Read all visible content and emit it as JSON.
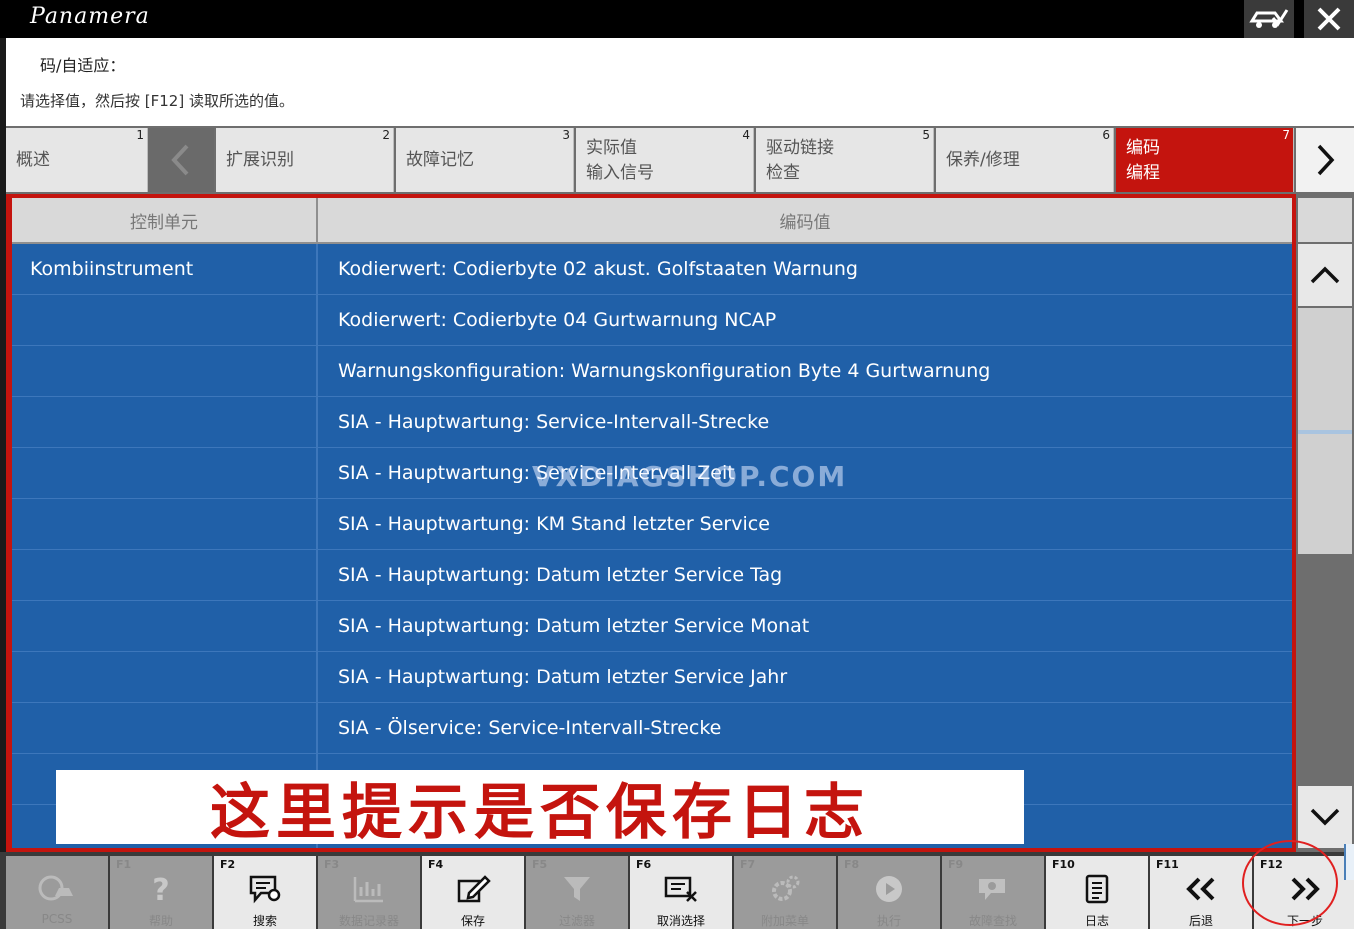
{
  "window": {
    "logo": "Panamera"
  },
  "header": {
    "title": "码/自适应：",
    "instruction": "请选择值，然后按 [F12] 读取所选的值。"
  },
  "tabs": [
    {
      "num": "1",
      "label": "概述"
    },
    {
      "num": "2",
      "label": "扩展识别"
    },
    {
      "num": "3",
      "label": "故障记忆"
    },
    {
      "num": "4",
      "label": "实际值\n输入信号"
    },
    {
      "num": "5",
      "label": "驱动链接\n检查"
    },
    {
      "num": "6",
      "label": "保养/修理"
    },
    {
      "num": "7",
      "label": "编码\n编程"
    }
  ],
  "table": {
    "col_control_unit": "控制单元",
    "col_coding_value": "编码值",
    "rows": [
      {
        "unit": "Kombiinstrument",
        "value": "Kodierwert: Codierbyte 02 akust. Golfstaaten Warnung"
      },
      {
        "unit": "",
        "value": "Kodierwert: Codierbyte 04 Gurtwarnung NCAP"
      },
      {
        "unit": "",
        "value": "Warnungskonfiguration: Warnungskonfiguration Byte 4 Gurtwarnung"
      },
      {
        "unit": "",
        "value": "SIA - Hauptwartung: Service-Intervall-Strecke"
      },
      {
        "unit": "",
        "value": "SIA - Hauptwartung: Service-Intervall Zeit"
      },
      {
        "unit": "",
        "value": "SIA - Hauptwartung: KM Stand letzter Service"
      },
      {
        "unit": "",
        "value": "SIA - Hauptwartung: Datum letzter Service Tag"
      },
      {
        "unit": "",
        "value": "SIA - Hauptwartung: Datum letzter Service Monat"
      },
      {
        "unit": "",
        "value": "SIA - Hauptwartung: Datum letzter Service Jahr"
      },
      {
        "unit": "",
        "value": "SIA - Ölservice: Service-Intervall-Strecke"
      },
      {
        "unit": "",
        "value": ""
      },
      {
        "unit": "",
        "value": ""
      }
    ]
  },
  "overlay": {
    "watermark": "VXDIAGSHOP.COM",
    "caption": "这里提示是否保存日志"
  },
  "toolbar": [
    {
      "key": "",
      "label": "PCSS",
      "icon": "car-icon",
      "enabled": false
    },
    {
      "key": "F1",
      "label": "帮助",
      "icon": "help-icon",
      "enabled": false
    },
    {
      "key": "F2",
      "label": "搜索",
      "icon": "search-bubble-icon",
      "enabled": true
    },
    {
      "key": "F3",
      "label": "数据记录器",
      "icon": "chart-icon",
      "enabled": false
    },
    {
      "key": "F4",
      "label": "保存",
      "icon": "save-edit-icon",
      "enabled": true
    },
    {
      "key": "F5",
      "label": "过滤器",
      "icon": "filter-icon",
      "enabled": false
    },
    {
      "key": "F6",
      "label": "取消选择",
      "icon": "deselect-icon",
      "enabled": true
    },
    {
      "key": "F7",
      "label": "附加菜单",
      "icon": "gear-icon",
      "enabled": false
    },
    {
      "key": "F8",
      "label": "执行",
      "icon": "play-icon",
      "enabled": false
    },
    {
      "key": "F9",
      "label": "故障查找",
      "icon": "troubleshoot-icon",
      "enabled": false
    },
    {
      "key": "F10",
      "label": "日志",
      "icon": "log-icon",
      "enabled": true
    },
    {
      "key": "F11",
      "label": "后退",
      "icon": "double-chevron-left-icon",
      "enabled": true
    },
    {
      "key": "F12",
      "label": "下一步",
      "icon": "double-chevron-right-icon",
      "enabled": true
    }
  ]
}
